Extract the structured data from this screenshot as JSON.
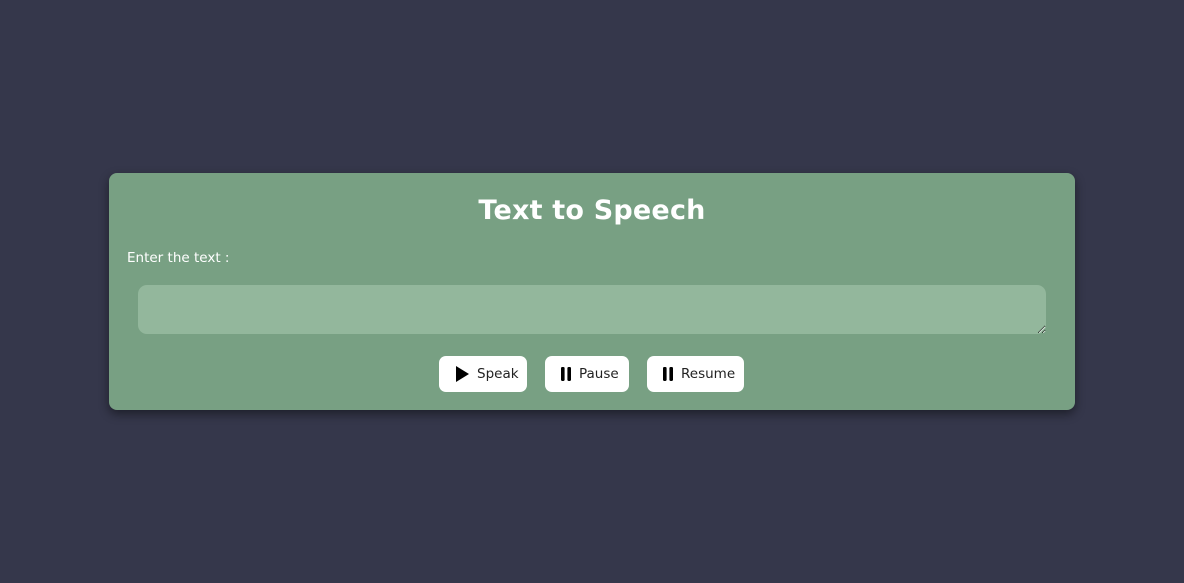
{
  "app": {
    "title": "Text to Speech"
  },
  "form": {
    "label": "Enter the text :",
    "textarea_value": "",
    "textarea_placeholder": ""
  },
  "buttons": {
    "speak": {
      "label": "Speak",
      "icon": "play-icon"
    },
    "pause": {
      "label": "Pause",
      "icon": "pause-icon"
    },
    "resume": {
      "label": "Resume",
      "icon": "pause-icon"
    }
  },
  "colors": {
    "background": "#35374b",
    "card": "#78a083",
    "textarea": "#93b79c",
    "button": "#ffffff",
    "text": "#ffffff"
  }
}
